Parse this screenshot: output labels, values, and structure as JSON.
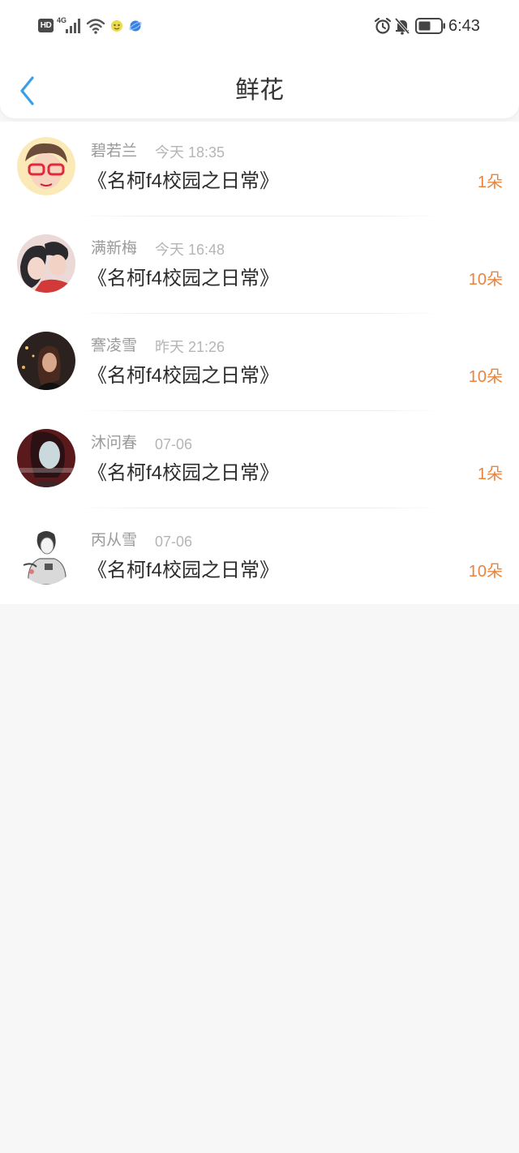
{
  "status_bar": {
    "hd_label": "HD",
    "network_label": "4G",
    "time": "6:43",
    "icons": [
      "hd-icon",
      "signal-icon",
      "wifi-icon",
      "app-notification-icon",
      "browser-notification-icon",
      "alarm-icon",
      "bell-off-icon",
      "battery-icon"
    ]
  },
  "nav": {
    "back_icon": "chevron-left-icon",
    "title": "鲜花"
  },
  "colors": {
    "accent_blue": "#3a9ee8",
    "count_orange": "#e9843f",
    "background": "#f8f7f8"
  },
  "items": [
    {
      "name": "碧若兰",
      "time": "今天 18:35",
      "book": "《名柯f4校园之日常》",
      "count": "1朵"
    },
    {
      "name": "满新梅",
      "time": "今天 16:48",
      "book": "《名柯f4校园之日常》",
      "count": "10朵"
    },
    {
      "name": "謇凌雪",
      "time": "昨天 21:26",
      "book": "《名柯f4校园之日常》",
      "count": "10朵"
    },
    {
      "name": "沐问春",
      "time": "07-06",
      "book": "《名柯f4校园之日常》",
      "count": "1朵"
    },
    {
      "name": "丙从雪",
      "time": "07-06",
      "book": "《名柯f4校园之日常》",
      "count": "10朵"
    }
  ]
}
